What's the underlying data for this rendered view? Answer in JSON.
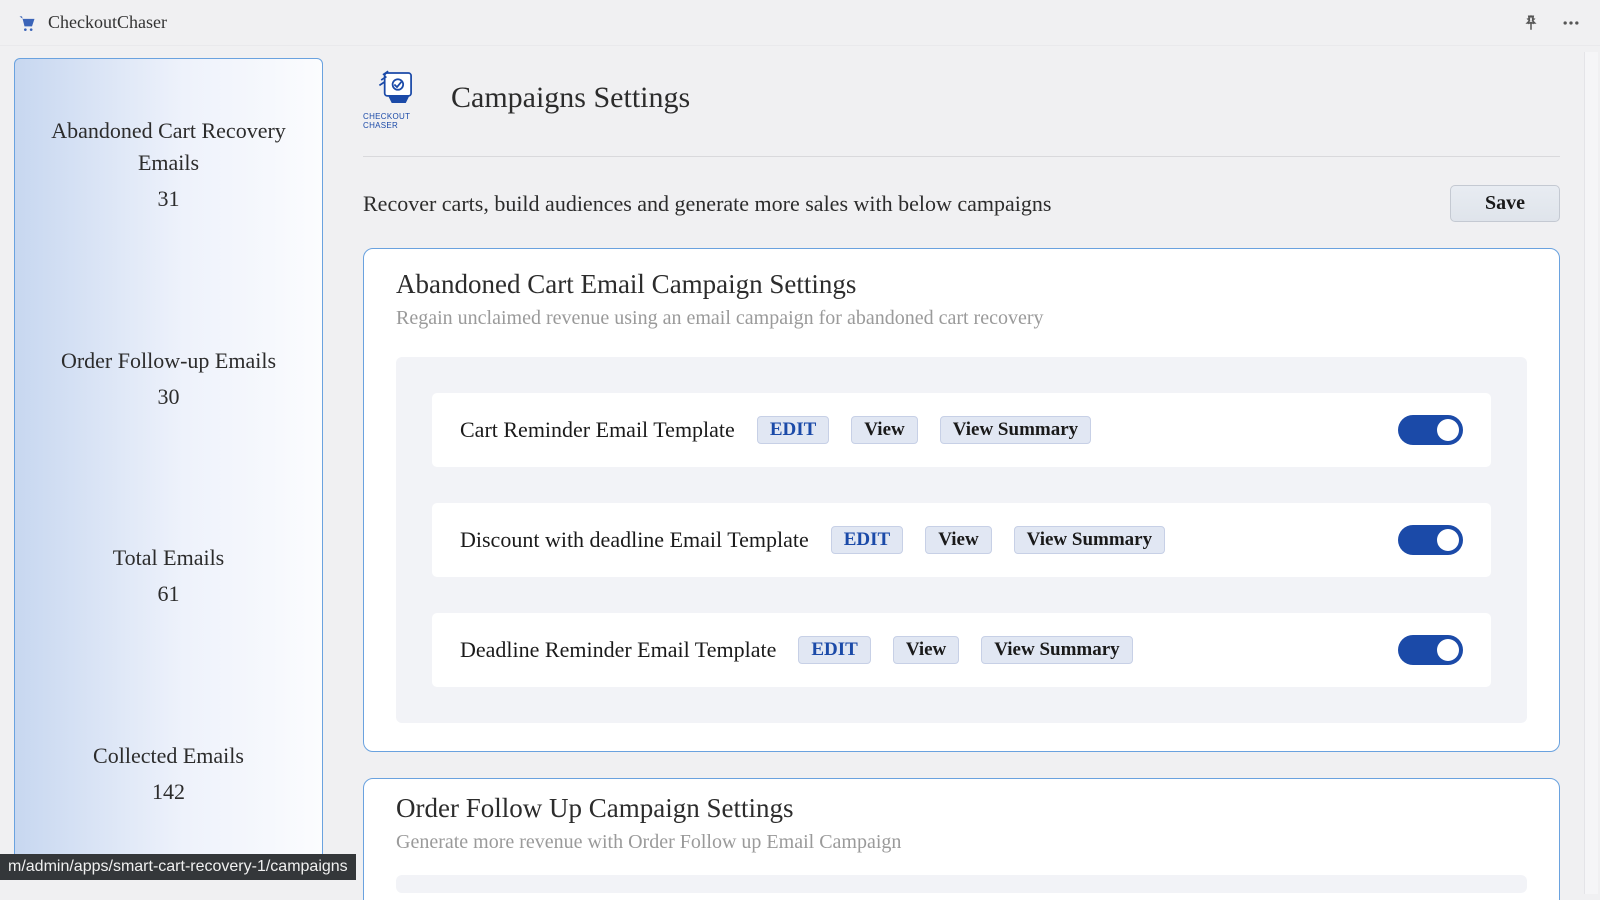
{
  "topbar": {
    "app_title": "CheckoutChaser"
  },
  "sidebar": {
    "stats": [
      {
        "label": "Abandoned Cart Recovery Emails",
        "value": "31"
      },
      {
        "label": "Order Follow-up Emails",
        "value": "30"
      },
      {
        "label": "Total Emails",
        "value": "61"
      },
      {
        "label": "Collected Emails",
        "value": "142"
      }
    ]
  },
  "page": {
    "title": "Campaigns Settings",
    "subtitle": "Recover carts, build audiences and generate more sales with below campaigns",
    "save_label": "Save",
    "brand_caption": "CHECKOUT CHASER"
  },
  "buttons": {
    "edit": "EDIT",
    "view": "View",
    "view_summary": "View Summary"
  },
  "campaigns": [
    {
      "title": "Abandoned Cart Email Campaign Settings",
      "subtitle": "Regain unclaimed revenue using an email campaign for abandoned cart recovery",
      "templates": [
        {
          "name": "Cart Reminder Email Template",
          "enabled": true
        },
        {
          "name": "Discount with deadline Email Template",
          "enabled": true
        },
        {
          "name": "Deadline Reminder Email Template",
          "enabled": true
        }
      ]
    },
    {
      "title": "Order Follow Up Campaign Settings",
      "subtitle": "Generate more revenue with Order Follow up Email Campaign",
      "templates": []
    }
  ],
  "status_url": "m/admin/apps/smart-cart-recovery-1/campaigns"
}
